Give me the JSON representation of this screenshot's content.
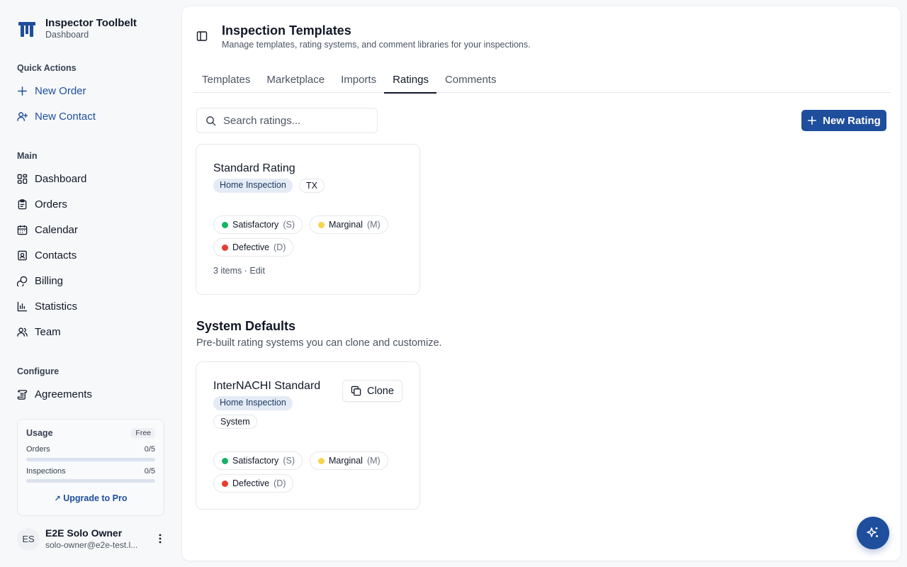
{
  "brand": {
    "name": "Inspector Toolbelt",
    "subtitle": "Dashboard"
  },
  "sidebar": {
    "quick_actions_label": "Quick Actions",
    "quick_actions": [
      {
        "label": "New Order",
        "icon": "plus-icon"
      },
      {
        "label": "New Contact",
        "icon": "user-plus-icon"
      }
    ],
    "main_label": "Main",
    "main_items": [
      {
        "label": "Dashboard",
        "icon": "dashboard-icon"
      },
      {
        "label": "Orders",
        "icon": "clipboard-icon"
      },
      {
        "label": "Calendar",
        "icon": "calendar-icon"
      },
      {
        "label": "Contacts",
        "icon": "contact-card-icon"
      },
      {
        "label": "Billing",
        "icon": "coins-icon"
      },
      {
        "label": "Statistics",
        "icon": "bar-chart-icon"
      },
      {
        "label": "Team",
        "icon": "users-icon"
      }
    ],
    "configure_label": "Configure",
    "configure_items": [
      {
        "label": "Agreements",
        "icon": "scroll-icon"
      }
    ],
    "usage": {
      "title": "Usage",
      "plan": "Free",
      "rows": [
        {
          "label": "Orders",
          "value": "0/5",
          "fraction": 0
        },
        {
          "label": "Inspections",
          "value": "0/5",
          "fraction": 0
        }
      ],
      "upgrade_label": "Upgrade to Pro"
    },
    "user": {
      "initials": "ES",
      "name": "E2E Solo Owner",
      "email": "solo-owner@e2e-test.l..."
    }
  },
  "header": {
    "title": "Inspection Templates",
    "subtitle": "Manage templates, rating systems, and comment libraries for your inspections."
  },
  "tabs": [
    {
      "label": "Templates",
      "active": false
    },
    {
      "label": "Marketplace",
      "active": false
    },
    {
      "label": "Imports",
      "active": false
    },
    {
      "label": "Ratings",
      "active": true
    },
    {
      "label": "Comments",
      "active": false
    }
  ],
  "search": {
    "placeholder": "Search ratings...",
    "value": ""
  },
  "new_rating_label": "New Rating",
  "colors": {
    "accent": "#1e4e9c",
    "satisfactory": "#16b364",
    "marginal": "#f7d44c",
    "defective": "#e53e30"
  },
  "custom_rating": {
    "title": "Standard Rating",
    "badges": [
      "Home Inspection",
      "TX"
    ],
    "levels": [
      {
        "name": "Satisfactory",
        "abbr": "(S)"
      },
      {
        "name": "Marginal",
        "abbr": "(M)"
      },
      {
        "name": "Defective",
        "abbr": "(D)"
      }
    ],
    "meta": "3 items · Edit"
  },
  "system_defaults": {
    "title": "System Defaults",
    "description": "Pre-built rating systems you can clone and customize.",
    "card": {
      "title": "InterNACHI Standard",
      "badges": [
        "Home Inspection",
        "System"
      ],
      "clone_label": "Clone",
      "levels": [
        {
          "name": "Satisfactory",
          "abbr": "(S)"
        },
        {
          "name": "Marginal",
          "abbr": "(M)"
        },
        {
          "name": "Defective",
          "abbr": "(D)"
        }
      ]
    }
  }
}
